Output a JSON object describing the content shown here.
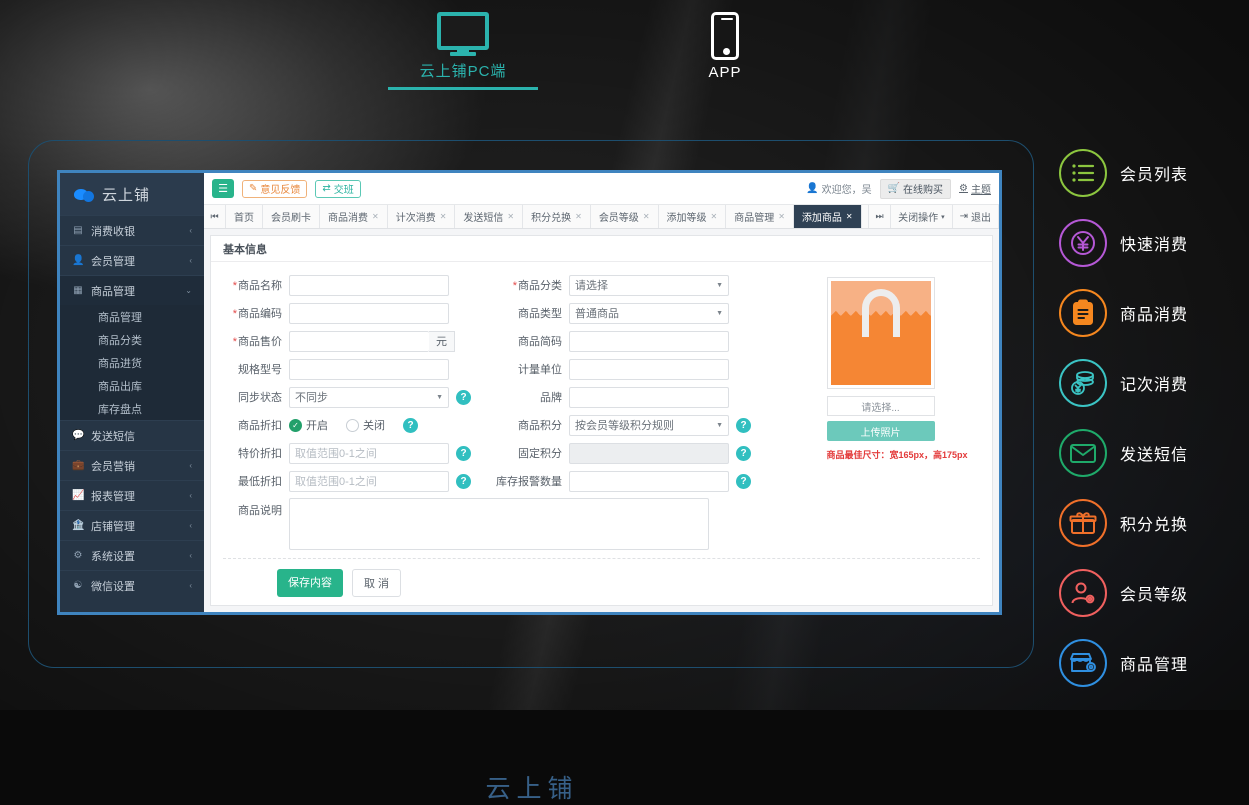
{
  "device_tabs": [
    {
      "label": "云上铺PC端",
      "icon": "monitor-icon",
      "active": true
    },
    {
      "label": "APP",
      "icon": "phone-icon",
      "active": false
    }
  ],
  "watermark": "云上铺",
  "app": {
    "logo": {
      "text": "云上铺",
      "icon": "cloud-logo-icon"
    },
    "sidebar": [
      {
        "label": "消费收银",
        "icon": "cash-register-icon",
        "arrow": "‹",
        "open": false
      },
      {
        "label": "会员管理",
        "icon": "user-icon",
        "arrow": "‹",
        "open": false
      },
      {
        "label": "商品管理",
        "icon": "box-icon",
        "arrow": "⌄",
        "open": true,
        "children": [
          "商品管理",
          "商品分类",
          "商品进货",
          "商品出库",
          "库存盘点"
        ]
      },
      {
        "label": "发送短信",
        "icon": "chat-icon",
        "arrow": "",
        "open": false
      },
      {
        "label": "会员营销",
        "icon": "briefcase-icon",
        "arrow": "‹",
        "open": false
      },
      {
        "label": "报表管理",
        "icon": "chart-icon",
        "arrow": "‹",
        "open": false
      },
      {
        "label": "店铺管理",
        "icon": "shop-icon",
        "arrow": "‹",
        "open": false
      },
      {
        "label": "系统设置",
        "icon": "wrench-icon",
        "arrow": "‹",
        "open": false
      },
      {
        "label": "微信设置",
        "icon": "wechat-icon",
        "arrow": "‹",
        "open": false
      }
    ],
    "topbar": {
      "menu_icon": "hamburger-icon",
      "feedback": "意见反馈",
      "feedback_icon": "pencil-icon",
      "shift": "交班",
      "shift_icon": "swap-icon",
      "welcome": "欢迎您，吴",
      "welcome_icon": "user-icon",
      "buy": "在线购买",
      "buy_icon": "cart-icon",
      "theme": "主题",
      "theme_icon": "gear-icon"
    },
    "tabs": {
      "prev_icon": "double-left-icon",
      "next_icon": "double-right-icon",
      "items": [
        {
          "label": "首页",
          "closable": false,
          "active": false
        },
        {
          "label": "会员刷卡",
          "closable": false,
          "active": false
        },
        {
          "label": "商品消费",
          "closable": true,
          "active": false
        },
        {
          "label": "计次消费",
          "closable": true,
          "active": false
        },
        {
          "label": "发送短信",
          "closable": true,
          "active": false
        },
        {
          "label": "积分兑换",
          "closable": true,
          "active": false
        },
        {
          "label": "会员等级",
          "closable": true,
          "active": false
        },
        {
          "label": "添加等级",
          "closable": true,
          "active": false
        },
        {
          "label": "商品管理",
          "closable": true,
          "active": false
        },
        {
          "label": "添加商品",
          "closable": true,
          "active": true
        }
      ],
      "close_ops": "关闭操作",
      "logout": "退出",
      "logout_icon": "exit-icon"
    },
    "panel_title": "基本信息",
    "form": {
      "left": [
        {
          "label": "商品名称",
          "required": true,
          "type": "input",
          "value": "",
          "placeholder": "",
          "help": false
        },
        {
          "label": "商品编码",
          "required": true,
          "type": "input",
          "value": "",
          "placeholder": "",
          "help": false
        },
        {
          "label": "商品售价",
          "required": true,
          "type": "input-unit",
          "value": "",
          "unit": "元",
          "help": false
        },
        {
          "label": "规格型号",
          "required": false,
          "type": "input",
          "value": "",
          "placeholder": "",
          "help": false
        },
        {
          "label": "同步状态",
          "required": false,
          "type": "select",
          "value": "不同步",
          "help": true
        },
        {
          "label": "商品折扣",
          "required": false,
          "type": "radio",
          "options": [
            {
              "text": "开启",
              "on": true
            },
            {
              "text": "关闭",
              "on": false
            }
          ],
          "help": true
        },
        {
          "label": "特价折扣",
          "required": false,
          "type": "input",
          "value": "",
          "placeholder": "取值范围0-1之间",
          "help": true
        },
        {
          "label": "最低折扣",
          "required": false,
          "type": "input",
          "value": "",
          "placeholder": "取值范围0-1之间",
          "help": true
        }
      ],
      "right": [
        {
          "label": "商品分类",
          "required": true,
          "type": "select",
          "value": "请选择",
          "help": false
        },
        {
          "label": "商品类型",
          "required": false,
          "type": "select",
          "value": "普通商品",
          "help": false
        },
        {
          "label": "商品简码",
          "required": false,
          "type": "input",
          "value": "",
          "placeholder": "",
          "help": false
        },
        {
          "label": "计量单位",
          "required": false,
          "type": "input",
          "value": "",
          "placeholder": "",
          "help": false
        },
        {
          "label": "品牌",
          "required": false,
          "type": "input",
          "value": "",
          "placeholder": "",
          "help": false
        },
        {
          "label": "商品积分",
          "required": false,
          "type": "select",
          "value": "按会员等级积分规则",
          "help": true
        },
        {
          "label": "固定积分",
          "required": false,
          "type": "input-disabled",
          "value": "",
          "help": true
        },
        {
          "label": "库存报警数量",
          "required": false,
          "type": "input",
          "value": "",
          "placeholder": "",
          "help": true
        }
      ],
      "description_label": "商品说明",
      "description_value": "",
      "image": {
        "thumb_icon": "shopping-bag-image",
        "choose": "请选择...",
        "upload": "上传照片",
        "size_hint": "商品最佳尺寸：宽165px，高175px"
      },
      "save": "保存内容",
      "cancel": "取 消"
    }
  },
  "features": [
    {
      "label": "会员列表",
      "icon": "list-icon",
      "color": "#8cc63f"
    },
    {
      "label": "快速消费",
      "icon": "yuan-circle-icon",
      "color": "#b558d6"
    },
    {
      "label": "商品消费",
      "icon": "clipboard-icon",
      "color": "#f5871f"
    },
    {
      "label": "记次消费",
      "icon": "coins-icon",
      "color": "#3bc4c4"
    },
    {
      "label": "发送短信",
      "icon": "envelope-icon",
      "color": "#1faa6a"
    },
    {
      "label": "积分兑换",
      "icon": "gift-icon",
      "color": "#f0702a"
    },
    {
      "label": "会员等级",
      "icon": "user-gear-icon",
      "color": "#f0605f"
    },
    {
      "label": "商品管理",
      "icon": "shop-gear-icon",
      "color": "#2f8fe0"
    }
  ],
  "colors": {
    "teal": "#2bb3ad",
    "sidebar_bg": "#263545",
    "accent_green": "#28b48b",
    "active_tab": "#2f4154",
    "frame_blue": "#3f84bf",
    "warn_red": "#e33a3a"
  }
}
